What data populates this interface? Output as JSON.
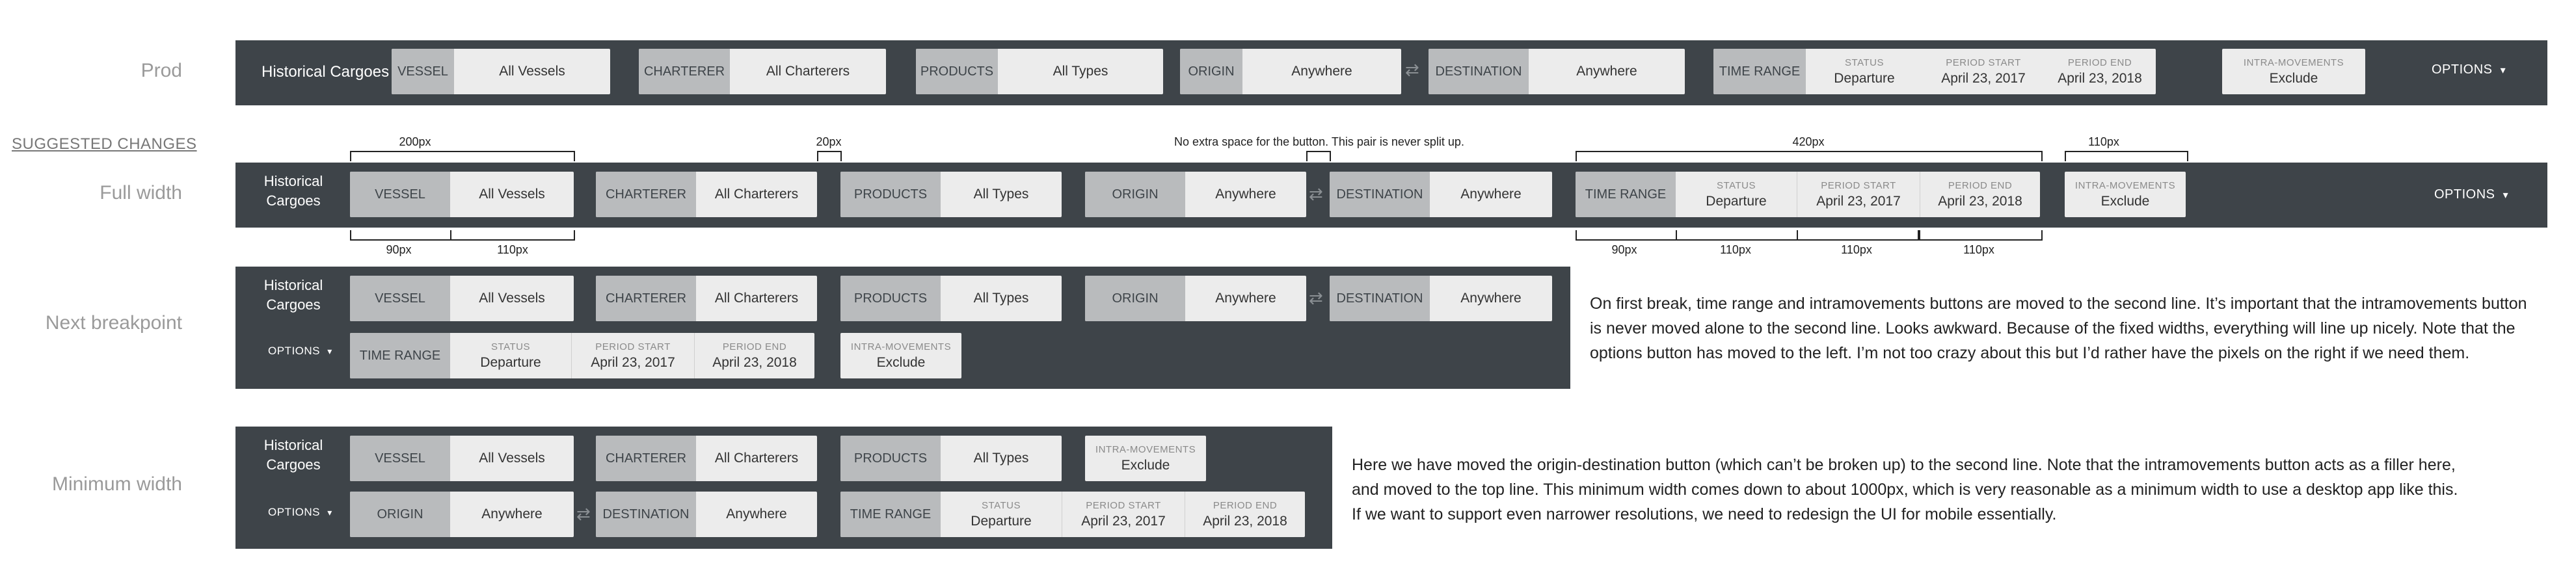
{
  "labels": {
    "prod": "Prod",
    "suggested": "SUGGESTED CHANGES",
    "full": "Full width",
    "next": "Next breakpoint",
    "min": "Minimum width"
  },
  "brand": {
    "one_line": "Historical Cargoes",
    "line1": "Historical",
    "line2": "Cargoes"
  },
  "filters": {
    "vessel": {
      "tag": "VESSEL",
      "value": "All Vessels"
    },
    "charterer": {
      "tag": "CHARTERER",
      "value": "All Charterers"
    },
    "products": {
      "tag": "PRODUCTS",
      "value": "All Types"
    },
    "origin": {
      "tag": "ORIGIN",
      "value": "Anywhere"
    },
    "destination": {
      "tag": "DESTINATION",
      "value": "Anywhere"
    },
    "time_range": {
      "tag": "TIME RANGE",
      "status_cap": "STATUS",
      "status": "Departure",
      "start_cap": "PERIOD START",
      "start": "April 23, 2017",
      "end_cap": "PERIOD END",
      "end": "April 23, 2018"
    },
    "intra": {
      "cap": "INTRA-MOVEMENTS",
      "value": "Exclude"
    }
  },
  "swap_glyph": "⇄",
  "options": "OPTIONS",
  "caret": "▾",
  "annotations": {
    "w200": "200px",
    "w20": "20px",
    "no_extra": "No extra space for the button. This pair is never split up.",
    "w420": "420px",
    "w110": "110px",
    "w90": "90px"
  },
  "notes": {
    "next": [
      "On first break, time range and intramovements buttons are moved to the second line. It’s important that the intramovements button",
      "is never moved alone to the second line. Looks awkward. Because of the fixed widths, everything will line up nicely. Note that the",
      "options button has moved to the left. I’m not too crazy about this but I’d rather have the pixels on the right if we need them."
    ],
    "min": [
      "Here we have moved the origin-destination button (which can’t be broken up) to the second line. Note that the intramovements button acts as a filler here,",
      "and moved to the top line. This minimum width comes down to about 1000px, which is very reasonable as a minimum width to use a desktop app like this.",
      "If we want to support even narrower resolutions, we need to redesign the UI for mobile essentially."
    ]
  }
}
